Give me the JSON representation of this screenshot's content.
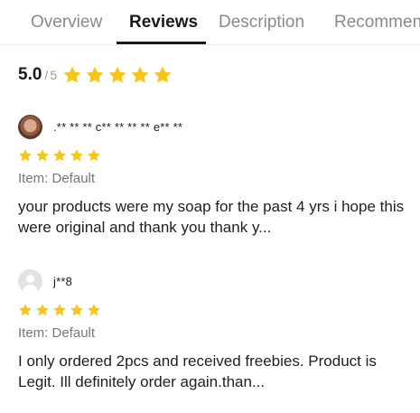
{
  "tabs": [
    {
      "label": "Overview"
    },
    {
      "label": "Reviews"
    },
    {
      "label": "Description"
    },
    {
      "label": "Recommen"
    }
  ],
  "rating_summary": {
    "value": "5.0",
    "separator": "/",
    "max": "5",
    "stars": 5,
    "star_color": "#f5c518"
  },
  "reviews": [
    {
      "reviewer_name": ".** ** ** c** ** ** ** e** **",
      "avatar": "user-photo",
      "stars": 5,
      "item_variant": "Item: Default",
      "text": "your products were my soap for the past 4 yrs i hope this were original and thank you thank y..."
    },
    {
      "reviewer_name": "j**8",
      "avatar": "default-avatar-icon",
      "stars": 5,
      "item_variant": "Item: Default",
      "text": "I only ordered 2pcs and received freebies. Product is Legit. Ill definitely order again.than..."
    }
  ]
}
